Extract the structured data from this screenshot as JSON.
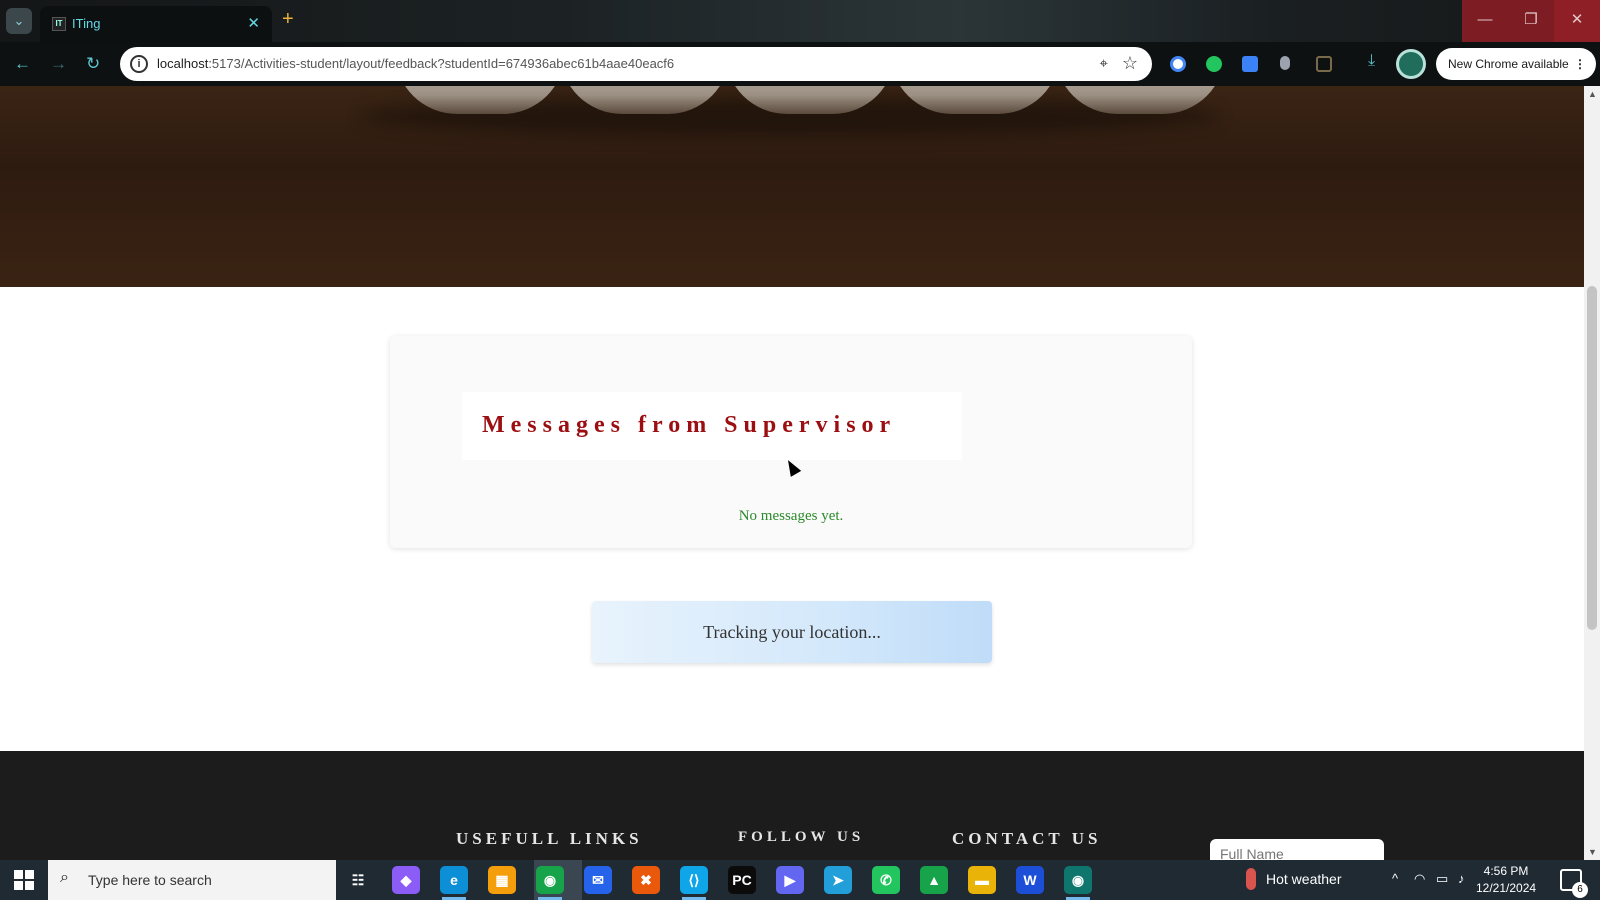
{
  "browser": {
    "tab_title": "ITing",
    "tab_favicon": "IT",
    "url_host": "localhost",
    "url_path": ":5173/Activities-student/layout/feedback?studentId=674936abec61b4aae40eacf6",
    "new_chrome_label": "New Chrome available",
    "new_tab_glyph": "+",
    "close_glyph": "✕",
    "minimize_glyph": "—",
    "maximize_glyph": "❐",
    "window_close_glyph": "✕",
    "back_glyph": "←",
    "forward_glyph": "→",
    "reload_glyph": "↻",
    "info_glyph": "i",
    "location_glyph": "⌖",
    "star_glyph": "☆",
    "menu_glyph": "⋮",
    "extension_colors": [
      "#4285f4",
      "#22c55e",
      "#3b82f6",
      "#9ca3af"
    ]
  },
  "page": {
    "messages_title": "Messages from Supervisor",
    "messages_empty": "No messages yet.",
    "tracking_status": "Tracking your location...",
    "footer": {
      "useful_links": "USEFULL LINKS",
      "follow_us": "FOLLOW US",
      "contact_us": "CONTACT US",
      "name_placeholder": "Full Name"
    },
    "colors": {
      "heading": "#9b0f12",
      "empty_text": "#2b8a2b",
      "footer_bg": "#1c1c1c"
    }
  },
  "taskbar": {
    "search_placeholder": "Type here to search",
    "search_glyph": "⌕",
    "weather": "Hot weather",
    "time": "4:56 PM",
    "date": "12/21/2024",
    "notification_count": "6",
    "tray_glyphs": [
      "^",
      "◠",
      "▭",
      "♪"
    ],
    "apps": [
      {
        "name": "task-view",
        "glyph": "☷",
        "color": "#1f2a33"
      },
      {
        "name": "copilot",
        "glyph": "◆",
        "color": "#8b5cf6"
      },
      {
        "name": "edge",
        "glyph": "e",
        "color": "#0c8fd6"
      },
      {
        "name": "store",
        "glyph": "▦",
        "color": "#f59e0b"
      },
      {
        "name": "chrome",
        "glyph": "◉",
        "color": "#16a34a"
      },
      {
        "name": "mail",
        "glyph": "✉",
        "color": "#2563eb"
      },
      {
        "name": "xampp",
        "glyph": "✖",
        "color": "#ea580c"
      },
      {
        "name": "vscode",
        "glyph": "⟨⟩",
        "color": "#0ea5e9"
      },
      {
        "name": "pycharm",
        "glyph": "PC",
        "color": "#0b0b0b"
      },
      {
        "name": "app-blue",
        "glyph": "▶",
        "color": "#6366f1"
      },
      {
        "name": "telegram",
        "glyph": "➤",
        "color": "#229ed9"
      },
      {
        "name": "whatsapp",
        "glyph": "✆",
        "color": "#22c55e"
      },
      {
        "name": "app-green",
        "glyph": "▲",
        "color": "#16a34a"
      },
      {
        "name": "file-explorer",
        "glyph": "▬",
        "color": "#eab308"
      },
      {
        "name": "word",
        "glyph": "W",
        "color": "#1d4ed8"
      },
      {
        "name": "chrome-profile",
        "glyph": "◉",
        "color": "#0f766e"
      }
    ]
  }
}
